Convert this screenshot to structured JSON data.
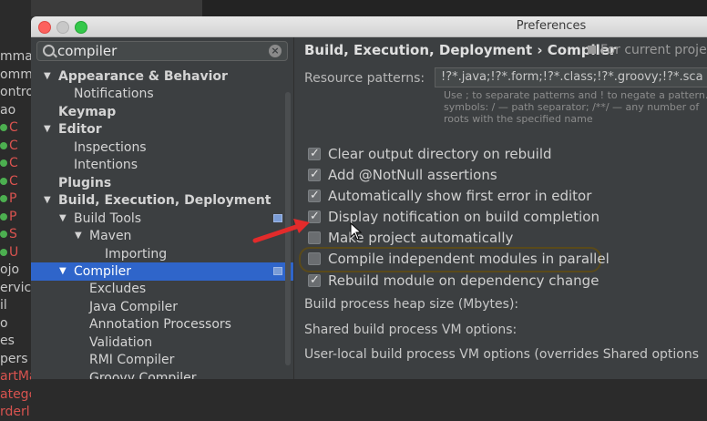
{
  "background": {
    "rows": [
      {
        "text": "mma",
        "red": false,
        "icon": false
      },
      {
        "text": "omm",
        "red": false,
        "icon": false
      },
      {
        "text": "ontro",
        "red": false,
        "icon": false
      },
      {
        "text": "ao",
        "red": false,
        "icon": false
      },
      {
        "text": "C",
        "red": true,
        "icon": true
      },
      {
        "text": "C",
        "red": true,
        "icon": true
      },
      {
        "text": "C",
        "red": true,
        "icon": true
      },
      {
        "text": "C",
        "red": true,
        "icon": true
      },
      {
        "text": "P",
        "red": true,
        "icon": true
      },
      {
        "text": "P",
        "red": true,
        "icon": true
      },
      {
        "text": "S",
        "red": true,
        "icon": true
      },
      {
        "text": "U",
        "red": true,
        "icon": true
      },
      {
        "text": "ojo",
        "red": false,
        "icon": false
      },
      {
        "text": "ervice",
        "red": false,
        "icon": false
      },
      {
        "text": "il",
        "red": false,
        "icon": false
      },
      {
        "text": "o",
        "red": false,
        "icon": false
      },
      {
        "text": "es",
        "red": false,
        "icon": false
      },
      {
        "text": "pers",
        "red": false,
        "icon": false
      },
      {
        "text": "artMa",
        "red": true,
        "icon": false
      },
      {
        "text": "ategc",
        "red": true,
        "icon": false
      },
      {
        "text": "rderl",
        "red": true,
        "icon": false
      }
    ]
  },
  "window": {
    "title": "Preferences"
  },
  "sidebar": {
    "search": {
      "value": "compiler",
      "placeholder": ""
    },
    "tree": [
      {
        "label": "Appearance & Behavior",
        "level": 0,
        "arrow": "▼",
        "bold": true,
        "selected": false
      },
      {
        "label": "Notifications",
        "level": 1,
        "arrow": "",
        "bold": false,
        "selected": false
      },
      {
        "label": "Keymap",
        "level": 0,
        "arrow": "",
        "bold": true,
        "selected": false
      },
      {
        "label": "Editor",
        "level": 0,
        "arrow": "▼",
        "bold": true,
        "selected": false
      },
      {
        "label": "Inspections",
        "level": 1,
        "arrow": "",
        "bold": false,
        "selected": false
      },
      {
        "label": "Intentions",
        "level": 1,
        "arrow": "",
        "bold": false,
        "selected": false
      },
      {
        "label": "Plugins",
        "level": 0,
        "arrow": "",
        "bold": true,
        "selected": false
      },
      {
        "label": "Build, Execution, Deployment",
        "level": 0,
        "arrow": "▼",
        "bold": true,
        "selected": false
      },
      {
        "label": "Build Tools",
        "level": 1,
        "arrow": "▼",
        "bold": false,
        "selected": false,
        "pin": true
      },
      {
        "label": "Maven",
        "level": 2,
        "arrow": "▼",
        "bold": false,
        "selected": false
      },
      {
        "label": "Importing",
        "level": 3,
        "arrow": "",
        "bold": false,
        "selected": false
      },
      {
        "label": "Compiler",
        "level": 1,
        "arrow": "▼",
        "bold": false,
        "selected": true,
        "pin": true
      },
      {
        "label": "Excludes",
        "level": 2,
        "arrow": "",
        "bold": false,
        "selected": false
      },
      {
        "label": "Java Compiler",
        "level": 2,
        "arrow": "",
        "bold": false,
        "selected": false
      },
      {
        "label": "Annotation Processors",
        "level": 2,
        "arrow": "",
        "bold": false,
        "selected": false
      },
      {
        "label": "Validation",
        "level": 2,
        "arrow": "",
        "bold": false,
        "selected": false
      },
      {
        "label": "RMI Compiler",
        "level": 2,
        "arrow": "",
        "bold": false,
        "selected": false
      },
      {
        "label": "Groovy Compiler",
        "level": 2,
        "arrow": "",
        "bold": false,
        "selected": false
      }
    ]
  },
  "main": {
    "breadcrumb": "Build, Execution, Deployment › Compiler",
    "for_current": "For current proje",
    "resource_patterns": {
      "label": "Resource patterns:",
      "value": "!?*.java;!?*.form;!?*.class;!?*.groovy;!?*.sca"
    },
    "hint_lines": [
      "Use ; to separate patterns and ! to negate a pattern. A",
      "symbols: / — path separator; /**/ — any number of",
      "roots with the specified name"
    ],
    "options": [
      {
        "label": "Clear output directory on rebuild",
        "checked": true
      },
      {
        "label": "Add @NotNull assertions",
        "checked": true
      },
      {
        "label": "Automatically show first error in editor",
        "checked": true
      },
      {
        "label": "Display notification on build completion",
        "checked": true
      },
      {
        "label": "Make project automatically",
        "checked": false
      },
      {
        "label": "Compile independent modules in parallel",
        "checked": false
      },
      {
        "label": "Rebuild module on dependency change",
        "checked": true
      }
    ],
    "heap_size_label": "Build process heap size (Mbytes):",
    "shared_vm_label": "Shared build process VM options:",
    "user_vm_label": "User-local build process VM options (overrides Shared options"
  },
  "colors": {
    "accent": "#2f65ca",
    "annotation_arrow": "#e32b2b"
  }
}
